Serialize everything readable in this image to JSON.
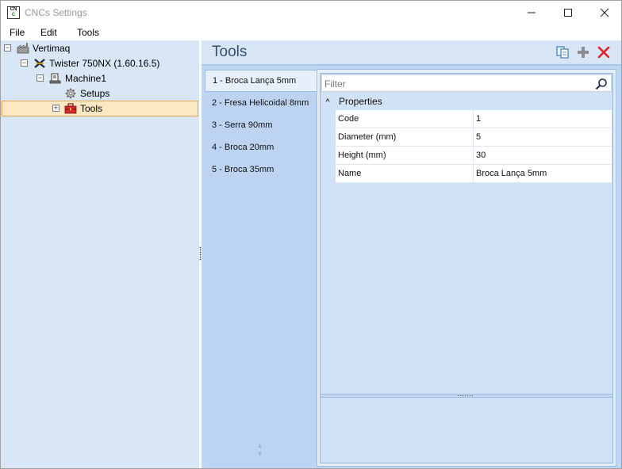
{
  "window": {
    "title": "CNCs Settings",
    "app_icon_text_top": "CN",
    "app_icon_text_bottom": "C"
  },
  "menu": {
    "file": "File",
    "edit": "Edit",
    "tools": "Tools"
  },
  "tree": {
    "root": "Vertimaq",
    "machine_model": "Twister 750NX (1.60.16.5)",
    "machine": "Machine1",
    "setups": "Setups",
    "tools": "Tools"
  },
  "panel": {
    "title": "Tools"
  },
  "tool_list": [
    "1 - Broca Lança 5mm",
    "2 - Fresa Helicoidal 8mm",
    "3 - Serra 90mm",
    "4 - Broca 20mm",
    "5 - Broca 35mm"
  ],
  "properties": {
    "filter_placeholder": "Filter",
    "category": "Properties",
    "rows": [
      {
        "key": "Code",
        "value": "1"
      },
      {
        "key": "Diameter (mm)",
        "value": "5"
      },
      {
        "key": "Height (mm)",
        "value": "30"
      },
      {
        "key": "Name",
        "value": "Broca Lança 5mm"
      }
    ]
  },
  "colors": {
    "accent": "#34506f",
    "selection": "#fde8c4",
    "delete": "#e0212b"
  }
}
